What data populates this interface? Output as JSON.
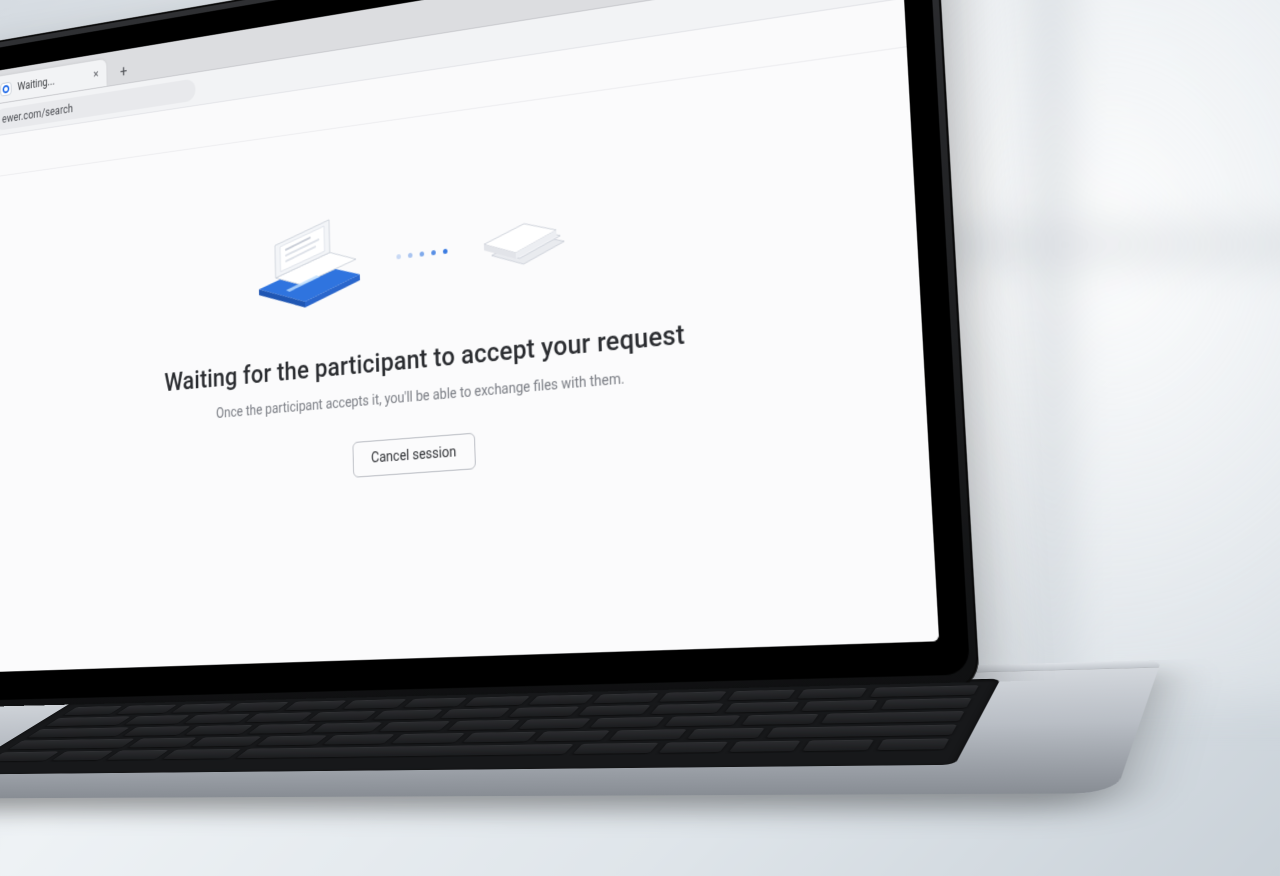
{
  "browser": {
    "tab_title": "Waiting...",
    "tab_favicon": "teamviewer-icon",
    "address": "ewer.com/search",
    "new_tab_glyph": "+",
    "close_tab_glyph": "×"
  },
  "page": {
    "headline": "Waiting for the participant to accept your request",
    "subtext": "Once the participant accepts it, you'll be able to exchange files with them.",
    "cancel_label": "Cancel session",
    "hero_left_icon": "laptop-transfer-icon",
    "hero_right_icon": "file-stack-icon"
  },
  "colors": {
    "accent": "#2f74df",
    "text_primary": "#2b2d31",
    "text_secondary": "#7a7d84",
    "button_border": "#b8bbc2"
  }
}
